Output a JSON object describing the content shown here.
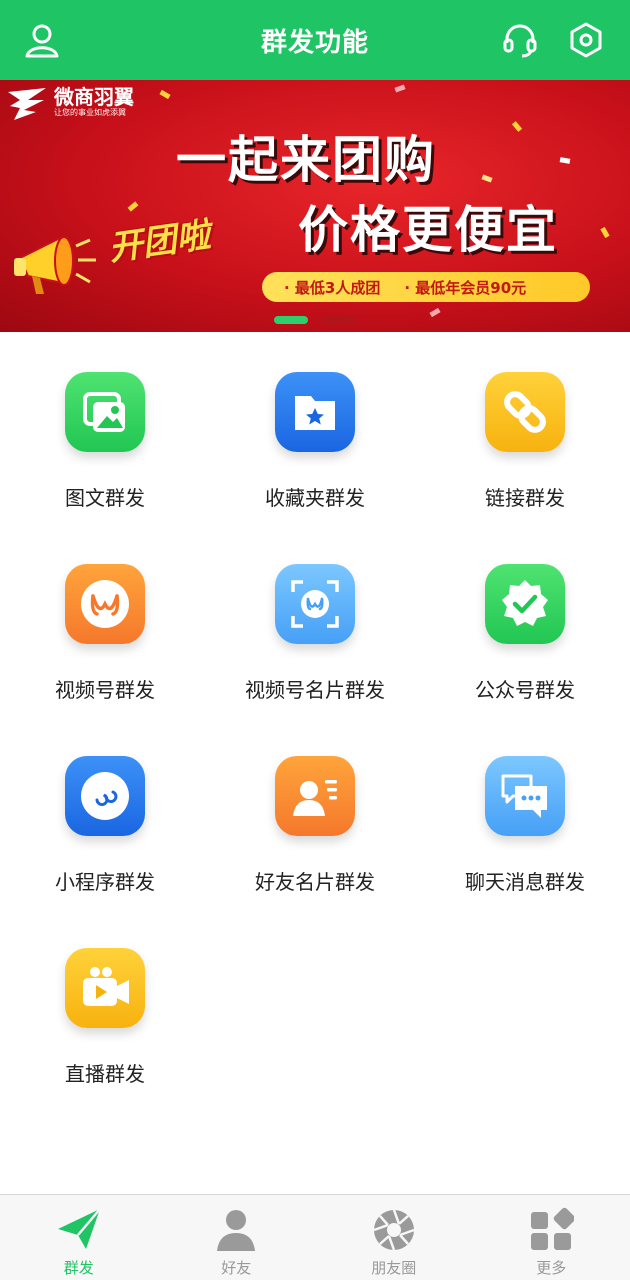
{
  "header": {
    "title": "群发功能",
    "icons": [
      "user-icon",
      "headset-icon",
      "settings-icon"
    ]
  },
  "banner": {
    "brand_name": "微商羽翼",
    "brand_slogan": "让您的事业如虎添翼",
    "headline1": "一起来团购",
    "headline2": "价格更便宜",
    "sticker": "开团啦",
    "promo1": "· 最低3人成团",
    "promo2": "· 最低年会员90元",
    "carousel": {
      "count": 2,
      "active": 1
    }
  },
  "features": [
    {
      "label": "图文群发",
      "icon": "image-text-icon",
      "color": "green"
    },
    {
      "label": "收藏夹群发",
      "icon": "favorites-folder-icon",
      "color": "blue"
    },
    {
      "label": "链接群发",
      "icon": "link-icon",
      "color": "yellow"
    },
    {
      "label": "视频号群发",
      "icon": "channels-icon",
      "color": "orange"
    },
    {
      "label": "视频号名片群发",
      "icon": "channels-card-icon",
      "color": "sky"
    },
    {
      "label": "公众号群发",
      "icon": "official-account-icon",
      "color": "green"
    },
    {
      "label": "小程序群发",
      "icon": "mini-program-icon",
      "color": "blue"
    },
    {
      "label": "好友名片群发",
      "icon": "contact-card-icon",
      "color": "orange"
    },
    {
      "label": "聊天消息群发",
      "icon": "chat-bubbles-icon",
      "color": "sky"
    },
    {
      "label": "直播群发",
      "icon": "live-video-icon",
      "color": "yellow"
    }
  ],
  "tabs": [
    {
      "label": "群发",
      "icon": "send-icon",
      "active": true
    },
    {
      "label": "好友",
      "icon": "person-icon",
      "active": false
    },
    {
      "label": "朋友圈",
      "icon": "aperture-icon",
      "active": false
    },
    {
      "label": "更多",
      "icon": "more-grid-icon",
      "active": false
    }
  ],
  "colors": {
    "primary": "#1fc465",
    "tab_inactive": "#999999",
    "banner_red": "#c8101a"
  }
}
